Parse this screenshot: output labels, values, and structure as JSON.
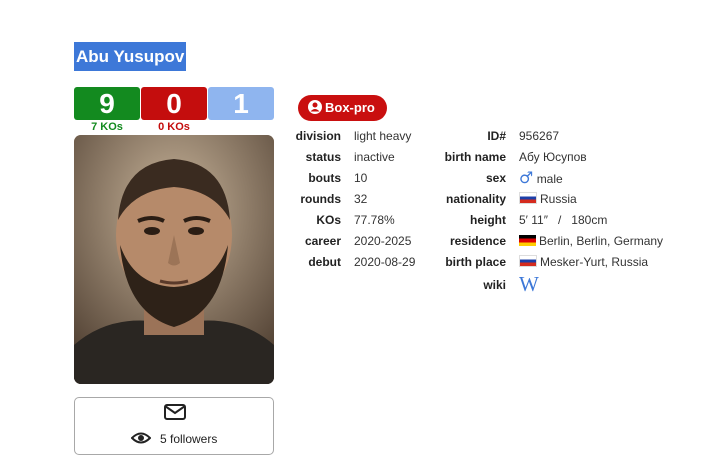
{
  "fighter": {
    "name": "Abu Yusupov"
  },
  "record": {
    "wins": "9",
    "losses": "0",
    "draws": "1",
    "wins_kos": "7 KOs",
    "losses_kos": "0 KOs",
    "colors": {
      "wins": "#138a1f",
      "losses": "#c40d0d",
      "draws": "#8fb5ef"
    }
  },
  "photo": {
    "alt": "fighter portrait",
    "icon": "person-photo"
  },
  "social": {
    "followers": "5 followers",
    "message_icon": "envelope-icon",
    "eye_icon": "eye-icon"
  },
  "badge": {
    "label": "Box-pro",
    "icon": "user-circle-icon",
    "color": "#c90f0f"
  },
  "stats_left": [
    {
      "label": "division",
      "value": "light heavy"
    },
    {
      "label": "status",
      "value": "inactive"
    },
    {
      "label": "bouts",
      "value": "10"
    },
    {
      "label": "rounds",
      "value": "32"
    },
    {
      "label": "KOs",
      "value": "77.78%"
    },
    {
      "label": "career",
      "value": "2020-2025"
    },
    {
      "label": "debut",
      "value": "2020-08-29"
    }
  ],
  "stats_right": {
    "id": {
      "label": "ID#",
      "value": "956267"
    },
    "birth_name": {
      "label": "birth name",
      "value": "Абу Юсупов"
    },
    "sex": {
      "label": "sex",
      "value": "male",
      "icon": "male-symbol-icon"
    },
    "nationality": {
      "label": "nationality",
      "value": "Russia",
      "flag": "russia-flag"
    },
    "height": {
      "label": "height",
      "value": "5′ 11″   /   180cm"
    },
    "residence": {
      "label": "residence",
      "value": "Berlin, Berlin, Germany",
      "flag": "germany-flag"
    },
    "birth_place": {
      "label": "birth place",
      "value": "Mesker-Yurt, Russia",
      "flag": "russia-flag"
    },
    "wiki": {
      "label": "wiki",
      "icon": "wikipedia-icon"
    }
  }
}
